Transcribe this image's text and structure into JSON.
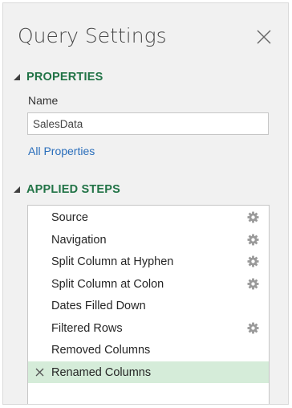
{
  "pane": {
    "title": "Query Settings"
  },
  "properties": {
    "header": "PROPERTIES",
    "name_label": "Name",
    "name_value": "SalesData",
    "all_properties_link": "All Properties"
  },
  "applied_steps": {
    "header": "APPLIED STEPS",
    "steps": [
      {
        "label": "Source",
        "has_settings": true,
        "selected": false
      },
      {
        "label": "Navigation",
        "has_settings": true,
        "selected": false
      },
      {
        "label": "Split Column at Hyphen",
        "has_settings": true,
        "selected": false
      },
      {
        "label": "Split Column at Colon",
        "has_settings": true,
        "selected": false
      },
      {
        "label": "Dates Filled Down",
        "has_settings": false,
        "selected": false
      },
      {
        "label": "Filtered Rows",
        "has_settings": true,
        "selected": false
      },
      {
        "label": "Removed Columns",
        "has_settings": false,
        "selected": false
      },
      {
        "label": "Renamed Columns",
        "has_settings": false,
        "selected": true
      }
    ]
  },
  "icons": {
    "close": "close-icon",
    "collapse": "collapse-triangle-icon",
    "settings": "gear-icon",
    "delete_step": "delete-step-icon"
  },
  "colors": {
    "section_header": "#217346",
    "link": "#2a6ebb",
    "selected_step": "#d5ecd9",
    "pane_background": "#f1f1f1"
  }
}
